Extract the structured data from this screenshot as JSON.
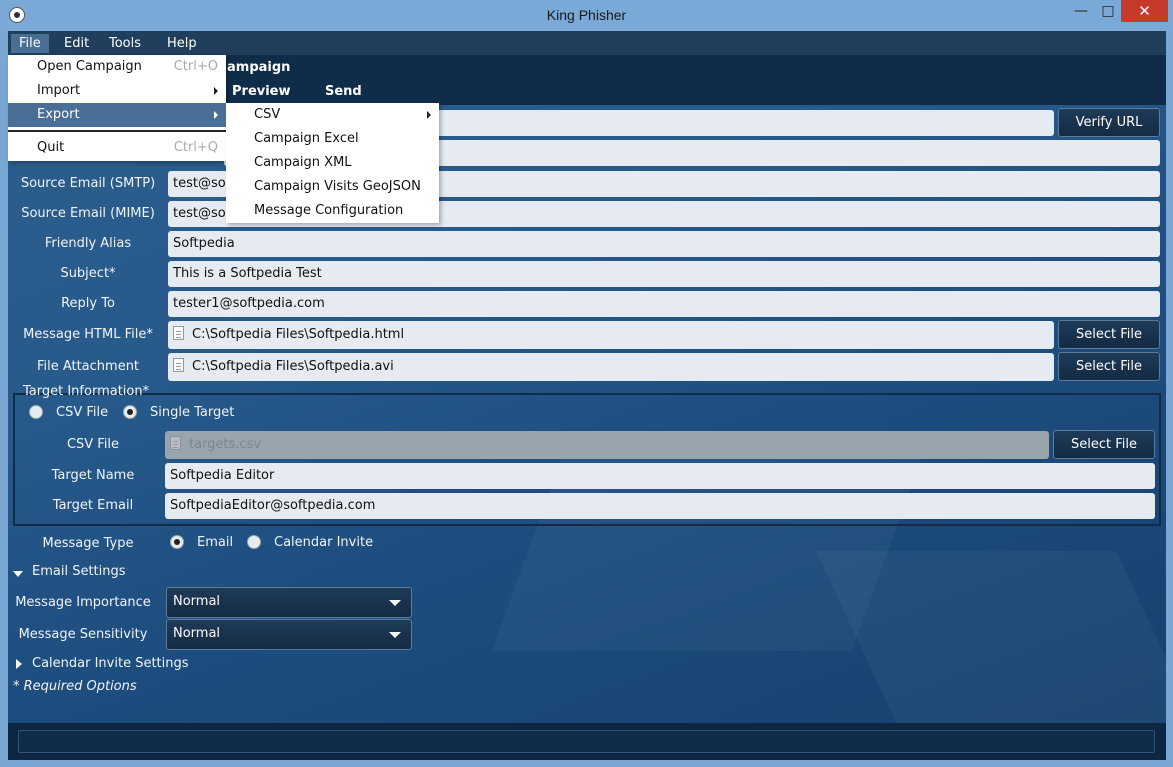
{
  "window": {
    "title": "King Phisher"
  },
  "menubar": [
    "File",
    "Edit",
    "Tools",
    "Help"
  ],
  "tabs": {
    "title": "ampaign",
    "items": [
      "Preview",
      "Send"
    ]
  },
  "form": {
    "verify_url_button": "Verify URL",
    "source_smtp_label": "Source Email (SMTP)",
    "source_smtp_value": "test@sof",
    "source_mime_label": "Source Email (MIME)",
    "source_mime_value": "test@so",
    "friendly_alias_label": "Friendly Alias",
    "friendly_alias_value": "Softpedia",
    "subject_label": "Subject*",
    "subject_value": "This is a Softpedia Test",
    "reply_to_label": "Reply To",
    "reply_to_value": "tester1@softpedia.com",
    "html_file_label": "Message HTML File*",
    "html_file_value": "C:\\Softpedia Files\\Softpedia.html",
    "attachment_label": "File Attachment",
    "attachment_value": "C:\\Softpedia Files\\Softpedia.avi",
    "select_file_button": "Select File"
  },
  "target": {
    "section_label": "Target Information*",
    "radio_csv": "CSV File",
    "radio_single": "Single Target",
    "csv_label": "CSV File",
    "csv_value": "targets.csv",
    "select_file_button": "Select File",
    "name_label": "Target Name",
    "name_value": "Softpedia Editor",
    "email_label": "Target Email",
    "email_value": "SoftpediaEditor@softpedia.com"
  },
  "message_type": {
    "label": "Message Type",
    "email": "Email",
    "calendar": "Calendar Invite"
  },
  "email_settings": {
    "label": "Email Settings",
    "importance_label": "Message Importance",
    "importance_value": "Normal",
    "sensitivity_label": "Message Sensitivity",
    "sensitivity_value": "Normal"
  },
  "calendar_settings": {
    "label": "Calendar Invite Settings"
  },
  "required_note": "* Required Options",
  "file_menu": {
    "open": "Open Campaign",
    "open_accel": "Ctrl+O",
    "import": "Import",
    "export": "Export",
    "quit": "Quit",
    "quit_accel": "Ctrl+Q"
  },
  "export_menu": [
    "CSV",
    "Campaign Excel",
    "Campaign XML",
    "Campaign Visits GeoJSON",
    "Message Configuration"
  ],
  "colors": {
    "accent": "#4a6f96",
    "titlebar": "#7aa9d8",
    "close": "#c7392b"
  }
}
